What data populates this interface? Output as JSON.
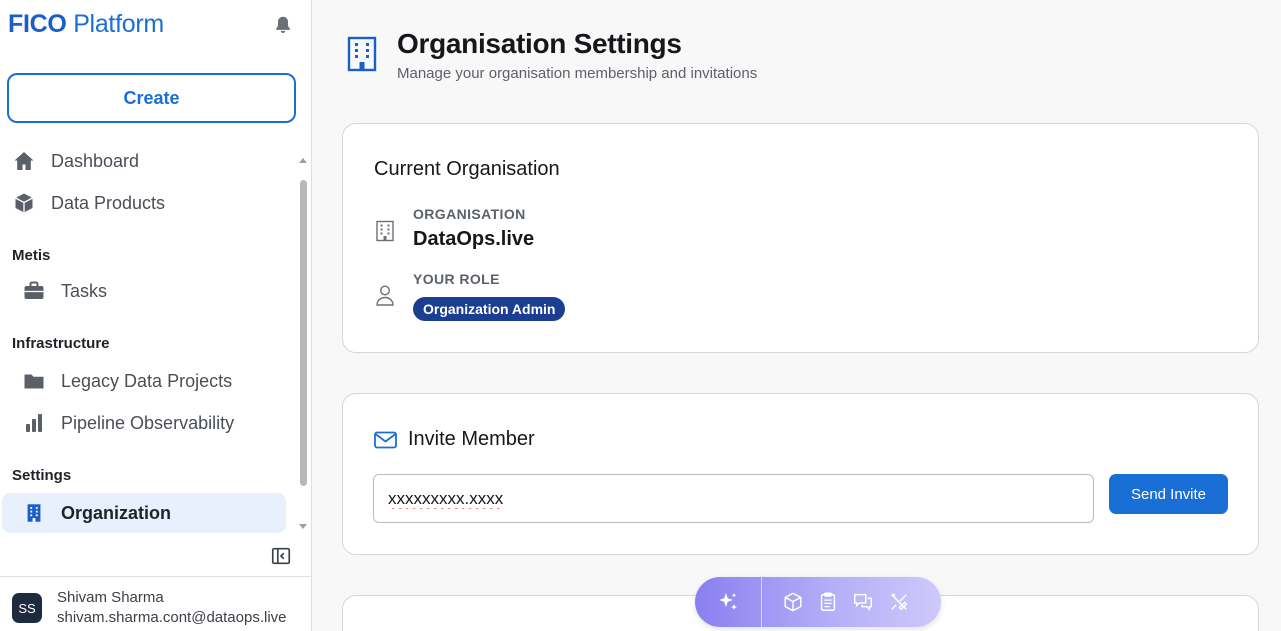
{
  "brand": {
    "part1": "FICO",
    "part2": "Platform"
  },
  "sidebar": {
    "create_label": "Create",
    "items": [
      {
        "label": "Dashboard",
        "icon": "home-icon"
      },
      {
        "label": "Data Products",
        "icon": "cube-icon"
      }
    ],
    "sections": [
      {
        "header": "Metis",
        "items": [
          {
            "label": "Tasks",
            "icon": "briefcase-icon"
          }
        ]
      },
      {
        "header": "Infrastructure",
        "items": [
          {
            "label": "Legacy Data Projects",
            "icon": "folder-icon"
          },
          {
            "label": "Pipeline Observability",
            "icon": "bar-chart-icon"
          }
        ]
      },
      {
        "header": "Settings",
        "items": [
          {
            "label": "Organization",
            "icon": "building-icon",
            "active": true
          }
        ]
      }
    ]
  },
  "user": {
    "initials": "SS",
    "name": "Shivam Sharma",
    "email": "shivam.sharma.cont@dataops.live"
  },
  "page": {
    "title": "Organisation Settings",
    "subtitle": "Manage your organisation membership and invitations"
  },
  "current_org": {
    "title": "Current Organisation",
    "org_label": "ORGANISATION",
    "org_name": "DataOps.live",
    "role_label": "YOUR ROLE",
    "role": "Organization Admin"
  },
  "invite": {
    "title": "Invite Member",
    "input_value": "xxxxxxxxx.xxxx",
    "send_label": "Send Invite"
  },
  "colors": {
    "accent": "#1a6fd6",
    "badge": "#1b3e91",
    "active_bg": "#e8f0fd"
  }
}
